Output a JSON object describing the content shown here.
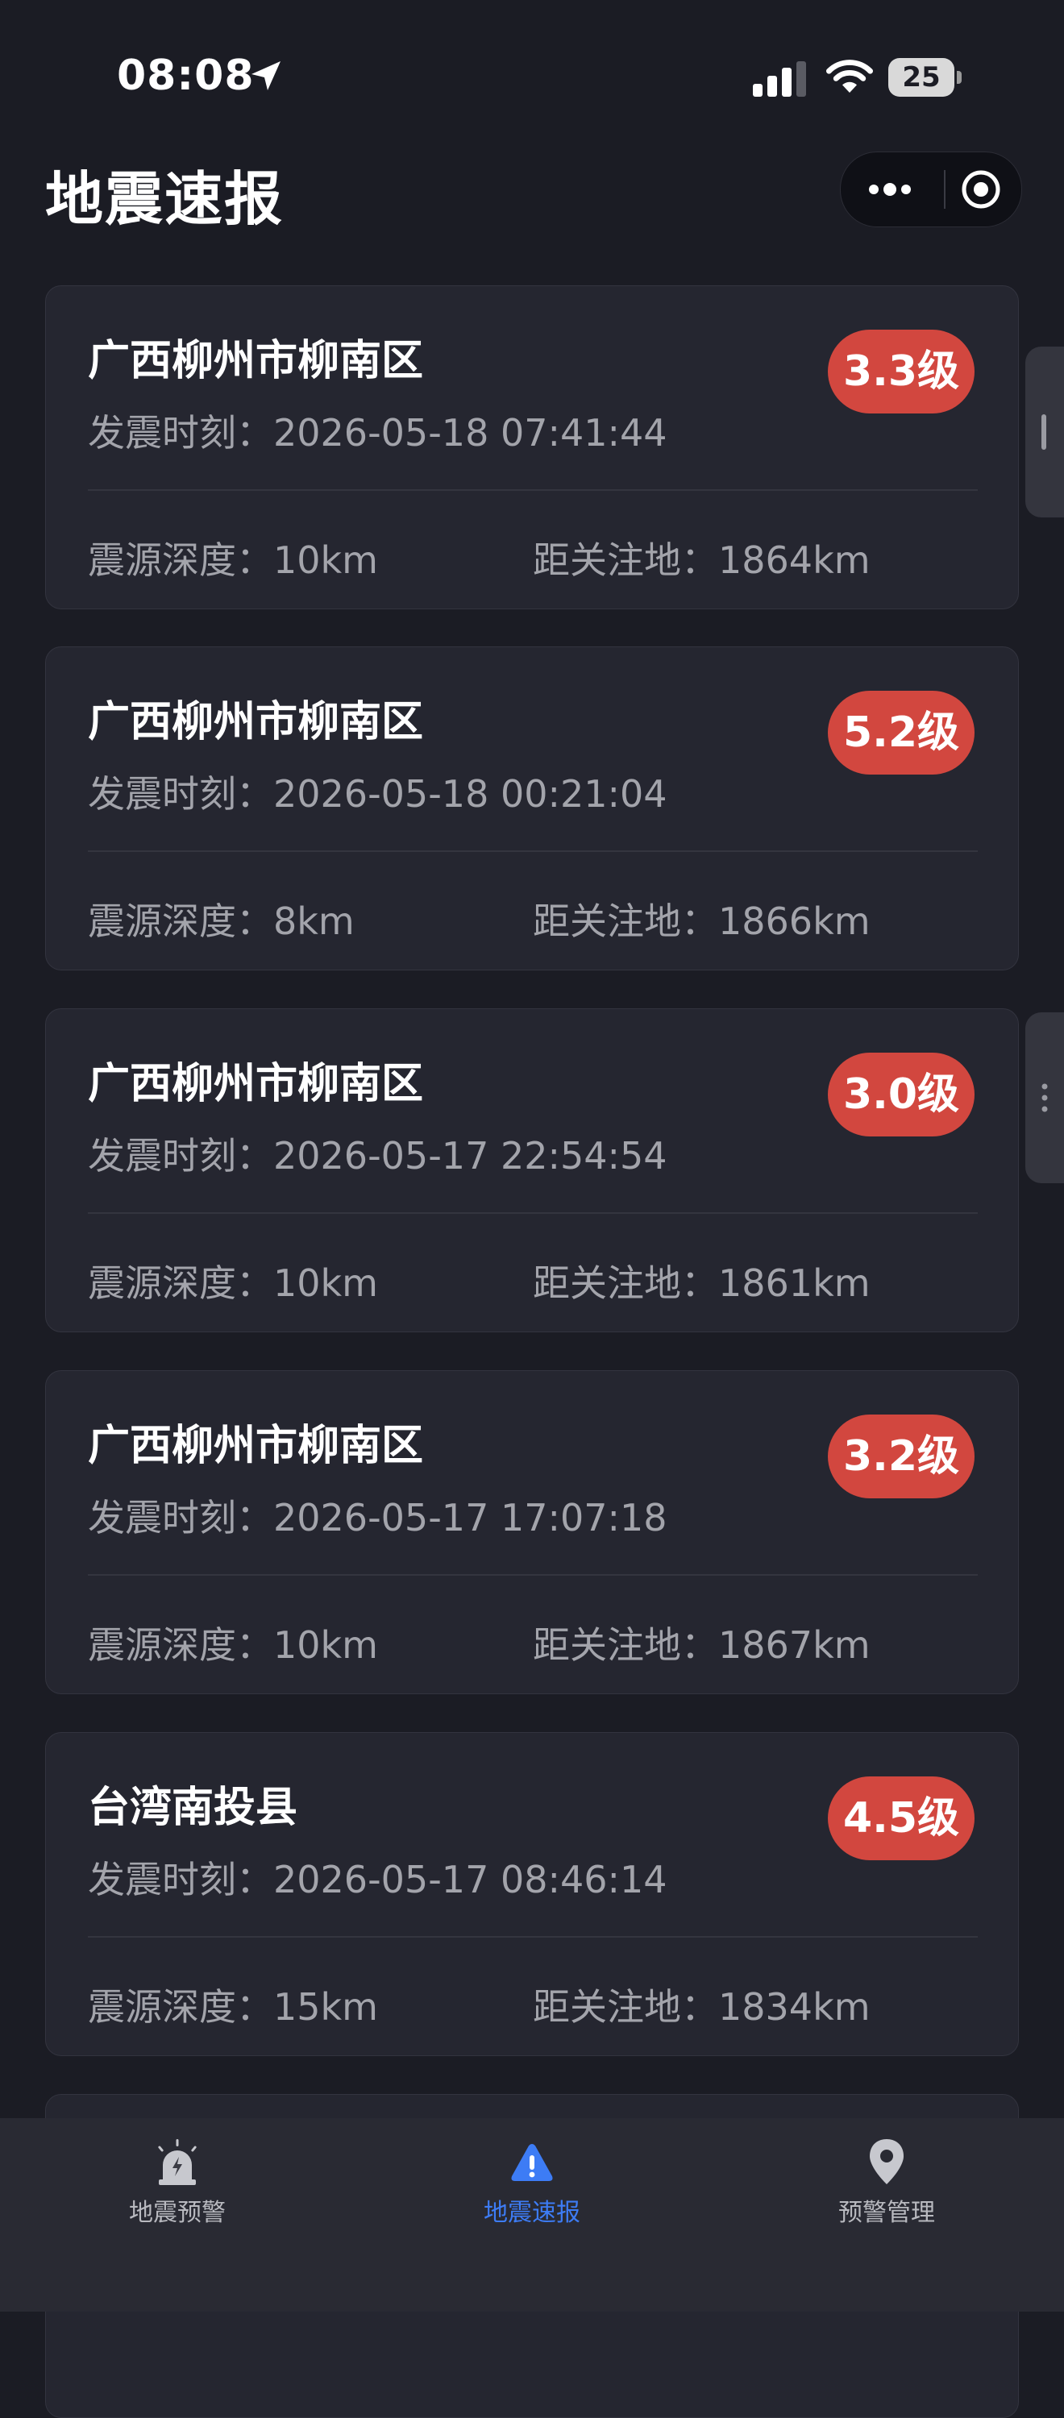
{
  "status_bar": {
    "time": "08:08",
    "battery": "25"
  },
  "header": {
    "title": "地震速报"
  },
  "cards": [
    {
      "location": "广西柳州市柳南区",
      "time": "发震时刻：2026-05-18 07:41:44",
      "magnitude": "3.3级",
      "depth": "震源深度：10km",
      "distance": "距关注地：1864km"
    },
    {
      "location": "广西柳州市柳南区",
      "time": "发震时刻：2026-05-18 00:21:04",
      "magnitude": "5.2级",
      "depth": "震源深度：8km",
      "distance": "距关注地：1866km"
    },
    {
      "location": "广西柳州市柳南区",
      "time": "发震时刻：2026-05-17 22:54:54",
      "magnitude": "3.0级",
      "depth": "震源深度：10km",
      "distance": "距关注地：1861km"
    },
    {
      "location": "广西柳州市柳南区",
      "time": "发震时刻：2026-05-17 17:07:18",
      "magnitude": "3.2级",
      "depth": "震源深度：10km",
      "distance": "距关注地：1867km"
    },
    {
      "location": "台湾南投县",
      "time": "发震时刻：2026-05-17 08:46:14",
      "magnitude": "4.5级",
      "depth": "震源深度：15km",
      "distance": "距关注地：1834km"
    }
  ],
  "bottom_nav": {
    "items": [
      {
        "label": "地震预警",
        "icon": "alarm-siren-icon",
        "active": false
      },
      {
        "label": "地震速报",
        "icon": "warning-alert-icon",
        "active": true
      },
      {
        "label": "预警管理",
        "icon": "location-pin-icon",
        "active": false
      }
    ]
  },
  "colors": {
    "background": "#1b1c24",
    "card": "#252630",
    "badge": "#d2473f",
    "accent": "#3d7cf5",
    "muted_text": "#a3a4ab"
  }
}
